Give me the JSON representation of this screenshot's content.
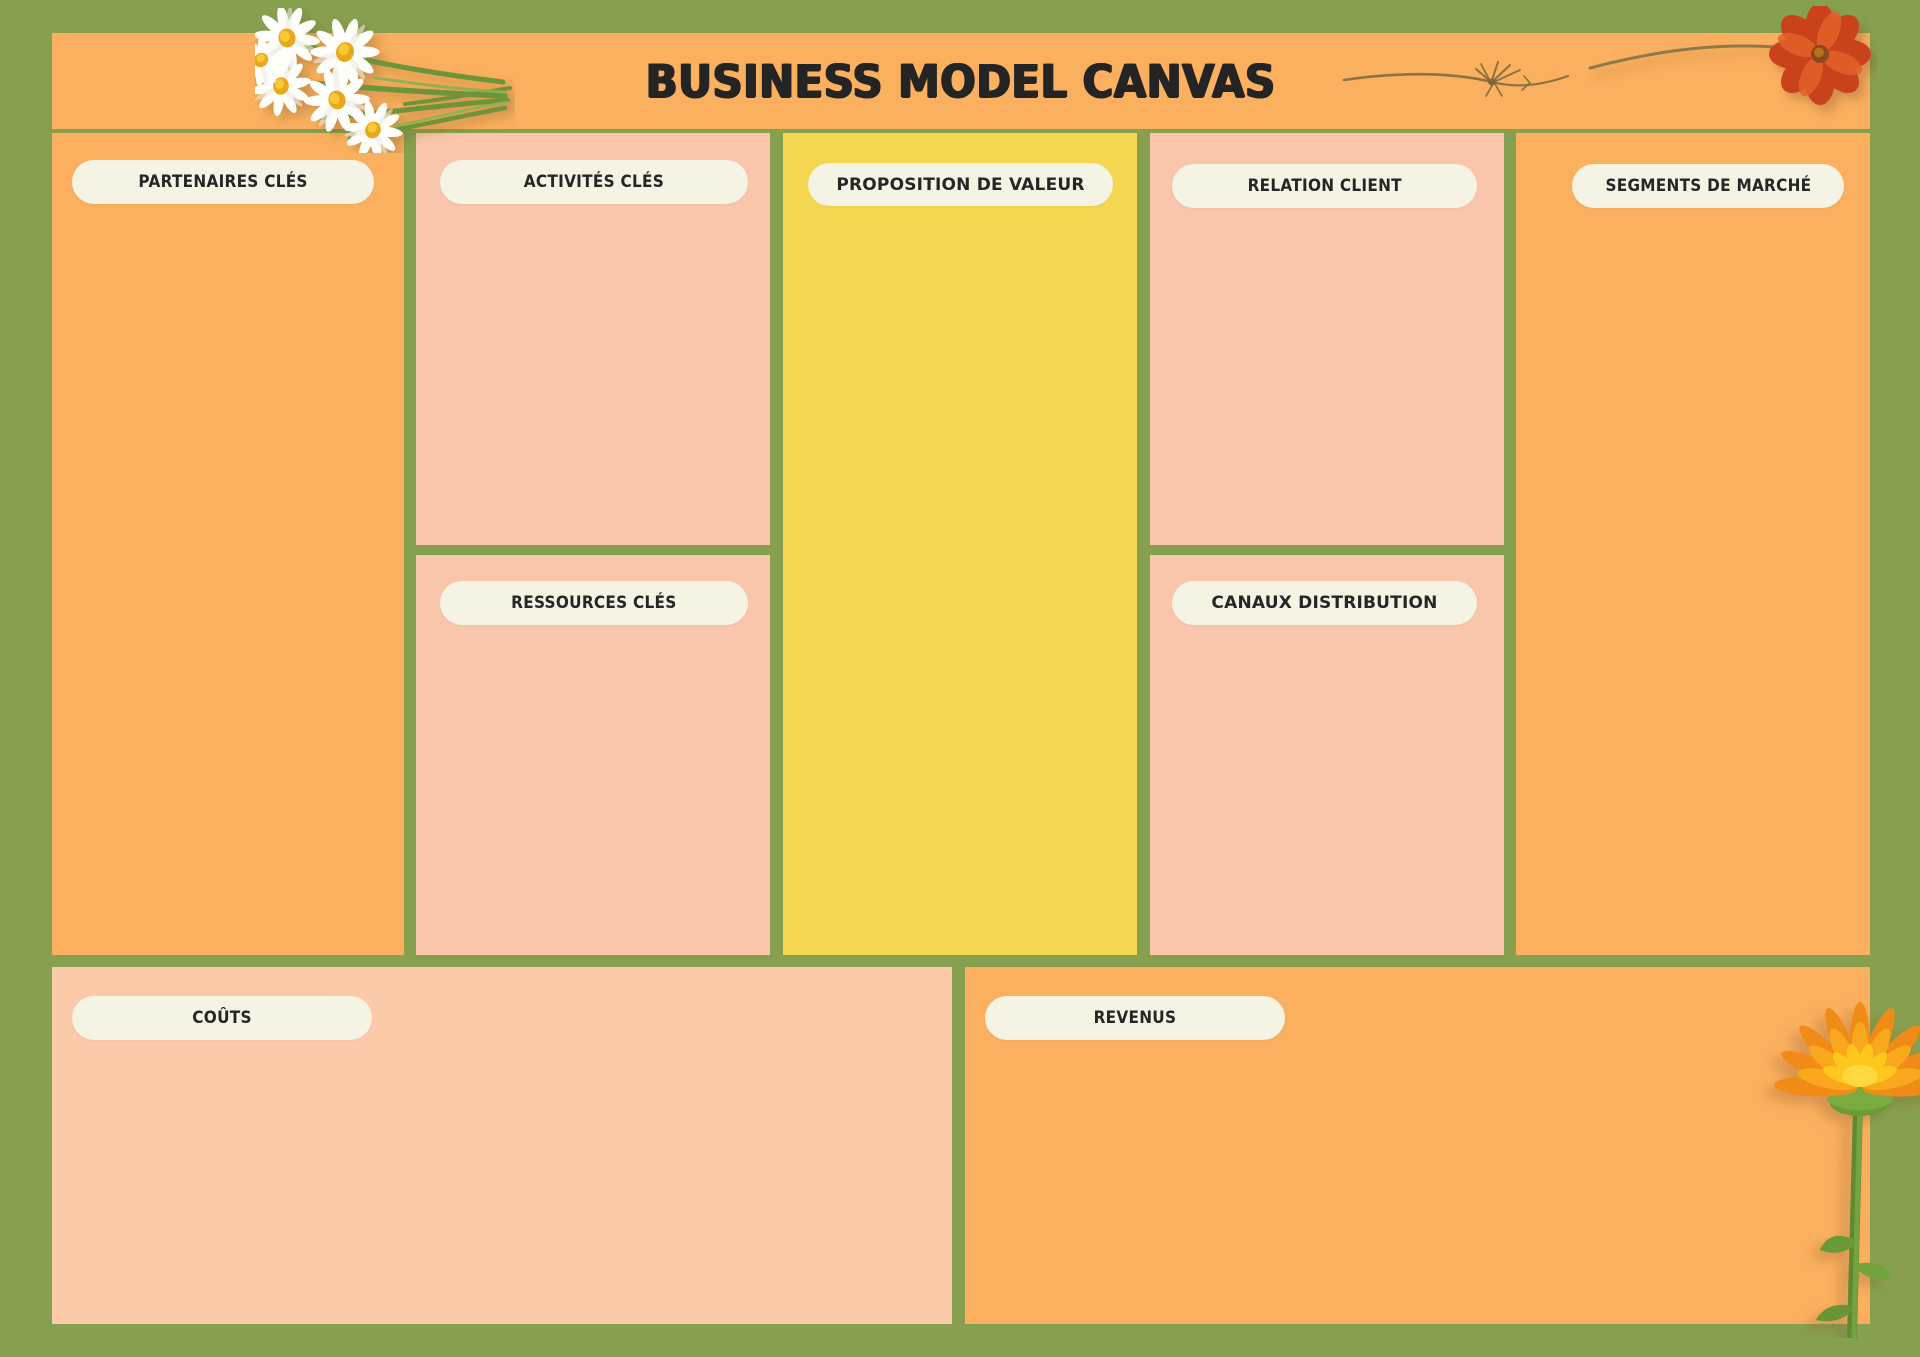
{
  "header": {
    "title": "BUSINESS MODEL CANVAS"
  },
  "colors": {
    "background_green": "#87a050",
    "panel_orange": "#fbb05f",
    "panel_peach": "#fac6ab",
    "panel_yellow": "#f4d751",
    "pill_cream": "#f5f4e4",
    "text_dark": "#262626"
  },
  "blocks": {
    "key_partners": {
      "label": "PARTENAIRES CLÉS",
      "color": "#fbb05f",
      "content": ""
    },
    "key_activities": {
      "label": "ACTIVITÉS CLÉS",
      "color": "#fac6ab",
      "content": ""
    },
    "key_resources": {
      "label": "RESSOURCES CLÉS",
      "color": "#fac6ab",
      "content": ""
    },
    "value_proposition": {
      "label": "PROPOSITION DE VALEUR",
      "color": "#f4d751",
      "content": ""
    },
    "customer_relationships": {
      "label": "RELATION CLIENT",
      "color": "#fac6ab",
      "content": ""
    },
    "channels": {
      "label": "CANAUX DISTRIBUTION",
      "color": "#fac6ab",
      "content": ""
    },
    "customer_segments": {
      "label": "SEGMENTS DE MARCHÉ",
      "color": "#fbb05f",
      "content": ""
    },
    "costs": {
      "label": "COÛTS",
      "color": "#fbcaa9",
      "content": ""
    },
    "revenue": {
      "label": "REVENUS",
      "color": "#fbb05f",
      "content": ""
    }
  },
  "decorations": [
    {
      "name": "daisy-cluster",
      "position": "top-left-header",
      "description": "white chamomile daisies with yellow centers and green stems"
    },
    {
      "name": "dried-twig",
      "position": "top-right-header",
      "description": "thin brown dried stem with small leaves"
    },
    {
      "name": "red-cosmos-flower",
      "position": "top-right-corner",
      "description": "red-orange cosmos bloom on long stem"
    },
    {
      "name": "marigold-flower",
      "position": "bottom-right",
      "description": "orange-yellow calendula marigold with tall green stem"
    }
  ]
}
